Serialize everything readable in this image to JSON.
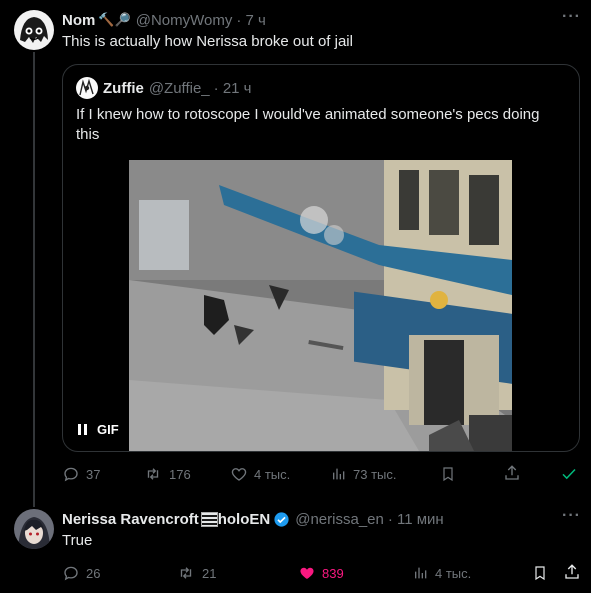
{
  "tweet1": {
    "display_name": "Nom",
    "name_emojis": "🔨🔎",
    "handle": "@NomyWomy",
    "time": "· 7 ч",
    "text": "This is actually how Nerissa broke out of jail",
    "more_label": "···",
    "actions": {
      "replies": "37",
      "retweets": "176",
      "likes": "4 тыс.",
      "views": "73 тыс."
    }
  },
  "quote": {
    "display_name": "Zuffie",
    "handle": "@Zuffie_",
    "time": "· 21 ч",
    "text": "If I knew how to rotoscope I would've animated someone's pecs doing this",
    "media_badge": "GIF"
  },
  "tweet2": {
    "display_name": "Nerissa Ravencroft",
    "name_suffix": "holoEN",
    "handle": "@nerissa_en",
    "time": "· 11 мин",
    "text": "True",
    "more_label": "···",
    "actions": {
      "replies": "26",
      "retweets": "21",
      "likes": "839",
      "views": "4 тыс."
    }
  },
  "colors": {
    "background": "#000000",
    "text": "#e7e9ea",
    "muted": "#71767b",
    "like_active": "#f91880",
    "verified": "#1d9bf0",
    "check": "#00ba7c"
  },
  "icons": [
    "reply-icon",
    "retweet-icon",
    "heart-icon",
    "views-icon",
    "bookmark-icon",
    "share-icon",
    "checkmark-icon",
    "verified-badge-icon",
    "pause-icon"
  ]
}
